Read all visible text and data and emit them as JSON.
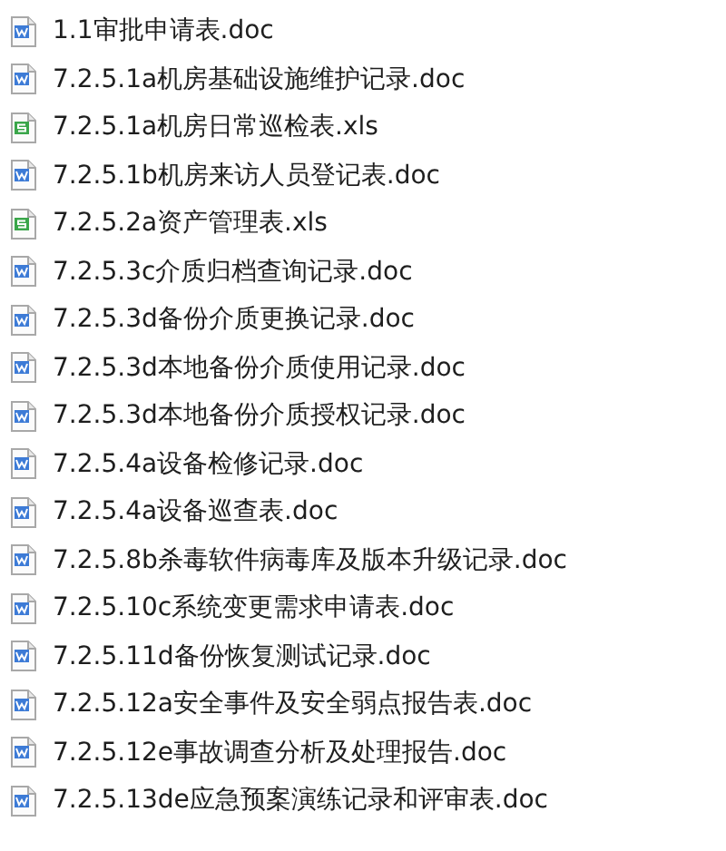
{
  "files": [
    {
      "name": "1.1审批申请表.doc",
      "kind": "doc"
    },
    {
      "name": "7.2.5.1a机房基础设施维护记录.doc",
      "kind": "doc"
    },
    {
      "name": "7.2.5.1a机房日常巡检表.xls",
      "kind": "xls"
    },
    {
      "name": "7.2.5.1b机房来访人员登记表.doc",
      "kind": "doc"
    },
    {
      "name": "7.2.5.2a资产管理表.xls",
      "kind": "xls"
    },
    {
      "name": "7.2.5.3c介质归档查询记录.doc",
      "kind": "doc"
    },
    {
      "name": "7.2.5.3d备份介质更换记录.doc",
      "kind": "doc"
    },
    {
      "name": "7.2.5.3d本地备份介质使用记录.doc",
      "kind": "doc"
    },
    {
      "name": "7.2.5.3d本地备份介质授权记录.doc",
      "kind": "doc"
    },
    {
      "name": "7.2.5.4a设备检修记录.doc",
      "kind": "doc"
    },
    {
      "name": "7.2.5.4a设备巡查表.doc",
      "kind": "doc"
    },
    {
      "name": "7.2.5.8b杀毒软件病毒库及版本升级记录.doc",
      "kind": "doc"
    },
    {
      "name": "7.2.5.10c系统变更需求申请表.doc",
      "kind": "doc"
    },
    {
      "name": "7.2.5.11d备份恢复测试记录.doc",
      "kind": "doc"
    },
    {
      "name": "7.2.5.12a安全事件及安全弱点报告表.doc",
      "kind": "doc"
    },
    {
      "name": "7.2.5.12e事故调查分析及处理报告.doc",
      "kind": "doc"
    },
    {
      "name": "7.2.5.13de应急预案演练记录和评审表.doc",
      "kind": "doc"
    }
  ]
}
